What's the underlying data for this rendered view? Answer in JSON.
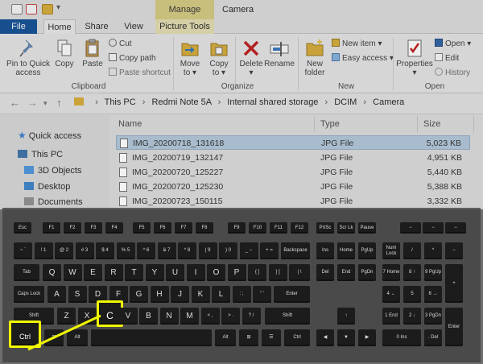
{
  "window": {
    "manage_tab": "Manage",
    "title": "Camera"
  },
  "ribbon_tabs": [
    "File",
    "Home",
    "Share",
    "View",
    "Picture Tools"
  ],
  "clipboard": {
    "pin_label_1": "Pin to Quick",
    "pin_label_2": "access",
    "copy": "Copy",
    "paste": "Paste",
    "cut": "Cut",
    "copy_path": "Copy path",
    "paste_shortcut": "Paste shortcut",
    "group": "Clipboard"
  },
  "organize": {
    "move_to_1": "Move",
    "move_to_2": "to",
    "copy_to_1": "Copy",
    "copy_to_2": "to",
    "delete_1": "Delete",
    "delete_2": "",
    "rename": "Rename",
    "group": "Organize"
  },
  "new_group": {
    "new_folder_1": "New",
    "new_folder_2": "folder",
    "new_item": "New item",
    "easy_access": "Easy access",
    "group": "New"
  },
  "open_group": {
    "properties": "Properties",
    "open": "Open",
    "edit": "Edit",
    "history": "History",
    "group": "Open"
  },
  "breadcrumb": [
    "This PC",
    "Redmi Note 5A",
    "Internal shared storage",
    "DCIM",
    "Camera"
  ],
  "nav_pane": [
    {
      "label": "Quick access",
      "icon": "star-icon",
      "color": "#3a78c4"
    },
    {
      "label": "This PC",
      "icon": "computer-icon",
      "color": "#3f6fa0"
    },
    {
      "label": "3D Objects",
      "icon": "cube-icon",
      "color": "#4b8fcf"
    },
    {
      "label": "Desktop",
      "icon": "desktop-icon",
      "color": "#3c7fc0"
    },
    {
      "label": "Documents",
      "icon": "documents-icon",
      "color": "#777777"
    }
  ],
  "columns": {
    "name": "Name",
    "type": "Type",
    "size": "Size"
  },
  "files": [
    {
      "name": "IMG_20200718_131618",
      "type": "JPG File",
      "size": "5,023 KB",
      "selected": true
    },
    {
      "name": "IMG_20200719_132147",
      "type": "JPG File",
      "size": "4,951 KB",
      "selected": false
    },
    {
      "name": "IMG_20200720_125227",
      "type": "JPG File",
      "size": "5,440 KB",
      "selected": false
    },
    {
      "name": "IMG_20200720_125230",
      "type": "JPG File",
      "size": "5,388 KB",
      "selected": false
    },
    {
      "name": "IMG_20200723_150115",
      "type": "JPG File",
      "size": "3,332 KB",
      "selected": false
    }
  ],
  "keyboard": {
    "highlight_color": "#f1f800",
    "highlighted_keys": [
      "Ctrl",
      "C"
    ],
    "fn_row": [
      "Esc",
      "F1",
      "F2",
      "F3",
      "F4",
      "F5",
      "F6",
      "F7",
      "F8",
      "F9",
      "F10",
      "F11",
      "F12",
      "PrtSc",
      "Scr Lk",
      "Pause",
      "−",
      "−",
      "−"
    ],
    "num_row": [
      "~ `",
      "! 1",
      "@ 2",
      "# 3",
      "$ 4",
      "% 5",
      "^ 6",
      "& 7",
      "* 8",
      "( 9",
      ") 0",
      "_ −",
      "+ =",
      "Backspace",
      "Ins",
      "Home",
      "PgUp",
      "Num Lock",
      "/",
      "*",
      "−"
    ],
    "qwerty_row": [
      "Tab",
      "Q",
      "W",
      "E",
      "R",
      "T",
      "Y",
      "U",
      "I",
      "O",
      "P",
      "{ [",
      "} ]",
      "| \\",
      "Del",
      "End",
      "PgDn",
      "7 Home",
      "8 ↑",
      "9 PgUp",
      "+"
    ],
    "home_row": [
      "Caps Lock",
      "A",
      "S",
      "D",
      "F",
      "G",
      "H",
      "J",
      "K",
      "L",
      ": ;",
      "\" '",
      "Enter",
      "4 ←",
      "5",
      "6 →"
    ],
    "shift_row": [
      "Shift",
      "Z",
      "X",
      "C",
      "V",
      "B",
      "N",
      "M",
      "< ,",
      "> .",
      "? /",
      "Shift",
      "↑",
      "1 End",
      "2 ↓",
      "3 PgDn",
      "Enter"
    ],
    "bottom_row": [
      "Ctrl",
      "⊞",
      "Alt",
      "",
      "Alt",
      "⊞",
      "☰",
      "Ctrl",
      "◀",
      "▼",
      "▶",
      "0 Ins",
      ". Del"
    ]
  }
}
